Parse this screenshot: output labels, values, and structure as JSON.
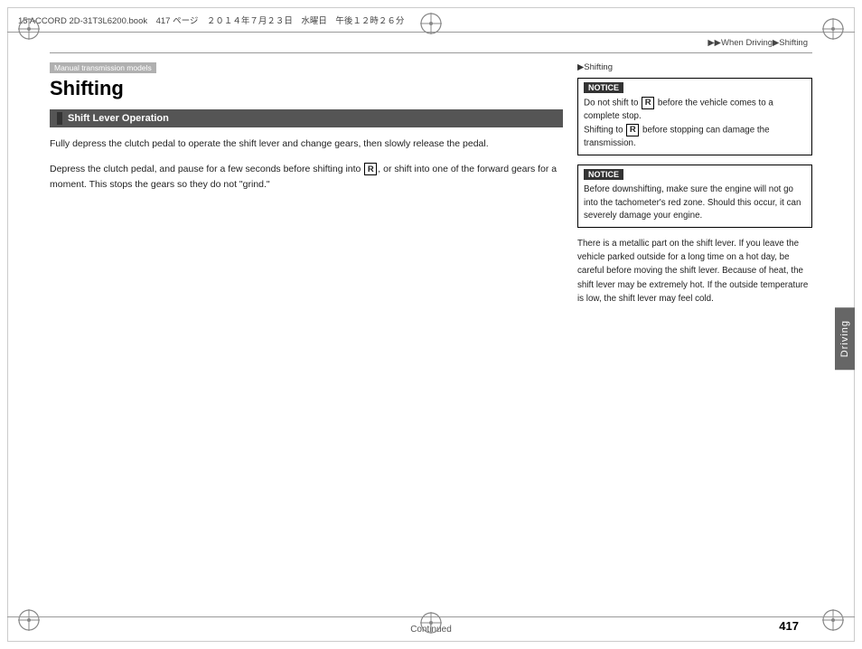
{
  "top_bar": {
    "text": "15 ACCORD 2D-31T3L6200.book　417 ページ　２０１４年７月２３日　水曜日　午後１２時２６分"
  },
  "breadcrumb": {
    "text": "▶▶When Driving▶Shifting"
  },
  "manual_badge": "Manual transmission models",
  "page_title": "Shifting",
  "section_header": "Shift Lever Operation",
  "left_paragraphs": [
    "Fully depress the clutch pedal to operate the shift lever and change gears, then slowly release the pedal.",
    "Depress the clutch pedal, and pause for a few seconds before shifting into R , or shift into one of the forward gears for a moment. This stops the gears so they do not \"grind.\""
  ],
  "right_section_label": "▶Shifting",
  "notice1": {
    "label": "NOTICE",
    "text": "Do not shift to R before the vehicle comes to a complete stop.\nShifting to R before stopping can damage the transmission."
  },
  "notice2": {
    "label": "NOTICE",
    "text": "Before downshifting, make sure the engine will not go into the tachometer's red zone. Should this occur, it can severely damage your engine."
  },
  "right_body_text": "There is a metallic part on the shift lever. If you leave the vehicle parked outside for a long time on a hot day, be careful before moving the shift lever. Because of heat, the shift lever may be extremely hot. If the outside temperature is low, the shift lever may feel cold.",
  "continued": "Continued",
  "page_number": "417",
  "driving_tab": "Driving"
}
